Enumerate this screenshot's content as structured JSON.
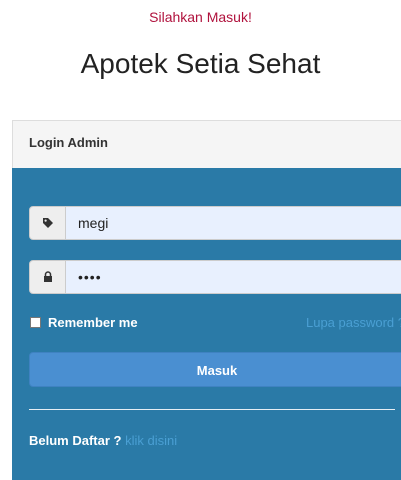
{
  "header": {
    "greeting": "Silahkan Masuk!",
    "brand": "Apotek Setia Sehat"
  },
  "login_panel": {
    "title": "Login Admin",
    "username": {
      "value": "megi",
      "icon": "tag-icon"
    },
    "password": {
      "masked_value": "••••",
      "icon": "lock-icon"
    },
    "remember_label": "Remember me",
    "remember_checked": false,
    "forgot_label": "Lupa password ?",
    "submit_label": "Masuk",
    "signup_prompt": "Belum Daftar ?",
    "signup_link": "klik disini"
  },
  "colors": {
    "greeting": "#b0123d",
    "panel_body": "#2a7aa7",
    "button": "#4a8fd1",
    "link": "#4a9fd3"
  }
}
